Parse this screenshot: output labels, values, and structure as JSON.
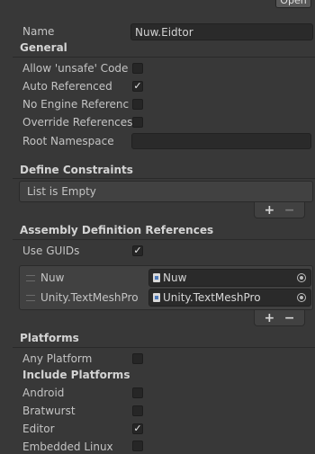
{
  "header": {
    "open_button": "Open"
  },
  "name_field": {
    "label": "Name",
    "value": "Nuw.Eidtor"
  },
  "general": {
    "title": "General",
    "allow_unsafe": {
      "label": "Allow 'unsafe' Code",
      "checked": false
    },
    "auto_referenced": {
      "label": "Auto Referenced",
      "checked": true
    },
    "no_engine_refs": {
      "label": "No Engine References",
      "checked": false
    },
    "override_refs": {
      "label": "Override References",
      "checked": false
    },
    "root_namespace": {
      "label": "Root Namespace",
      "value": ""
    }
  },
  "define_constraints": {
    "title": "Define Constraints",
    "empty_text": "List is Empty",
    "add": "+",
    "remove": "−"
  },
  "assembly_refs": {
    "title": "Assembly Definition References",
    "use_guids": {
      "label": "Use GUIDs",
      "checked": true
    },
    "items": [
      {
        "label": "Nuw",
        "value": "Nuw"
      },
      {
        "label": "Unity.TextMeshPro",
        "value": "Unity.TextMeshPro"
      }
    ],
    "add": "+",
    "remove": "−"
  },
  "platforms": {
    "title": "Platforms",
    "any_platform": {
      "label": "Any Platform",
      "checked": false
    },
    "include_title": "Include Platforms",
    "items": [
      {
        "label": "Android",
        "checked": false
      },
      {
        "label": "Bratwurst",
        "checked": false
      },
      {
        "label": "Editor",
        "checked": true
      },
      {
        "label": "Embedded Linux",
        "checked": false
      }
    ]
  },
  "icons": {
    "check": "✓",
    "object_picker": "picker-icon",
    "asset": "assembly-asset-icon"
  }
}
